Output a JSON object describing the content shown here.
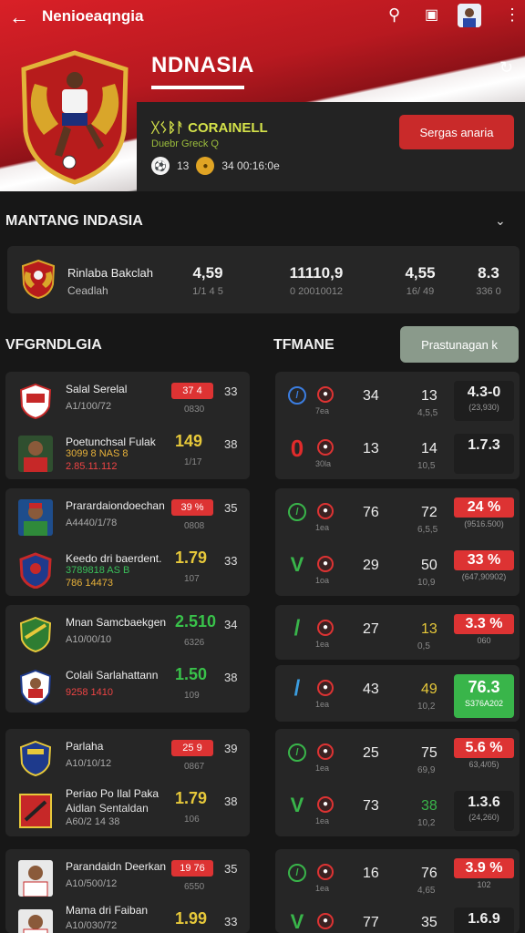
{
  "topbar": {
    "back_icon": "arrow-left-icon",
    "title": "Nenioeaqngia",
    "icons": [
      "search-icon",
      "share-icon",
      "avatar",
      "more-vertical-icon"
    ]
  },
  "hero": {
    "team_name": "NDNASIA",
    "subtitle": "ᚷᛊᛒᚨ CORAINELL",
    "subtitle2": "Duebr Greck Q",
    "stat1": "13",
    "stat2": "34 00:16:0e",
    "button": "Sergas anaria"
  },
  "section1": {
    "title": "MANTANG INDASIA",
    "summary": {
      "name": "Rinlaba Bakclah",
      "sub": "Ceadlah",
      "cols": [
        {
          "v": "4,59",
          "s": "1/1 4 5"
        },
        {
          "v": "11110,9",
          "s": "0 20010012"
        },
        {
          "v": "4,55",
          "s": "16/ 49"
        },
        {
          "v": "8.3",
          "s": "336 0"
        }
      ]
    }
  },
  "section2": {
    "left_title": "VFGRNDLGIA",
    "right_title": "TFMANE",
    "button": "Prastunagan k"
  },
  "left_cards": [
    {
      "rows": [
        {
          "name": "Salal Serelal",
          "sub": "A1/100/72",
          "pill": "37 4",
          "small": "0830",
          "rv": "33"
        },
        {
          "name": "Poetunchsal Fulak",
          "sub": "3099 8 NAS 8",
          "sub2": "2.85.11.112",
          "big": "149",
          "small": "1/17",
          "rv": "38"
        }
      ]
    },
    {
      "rows": [
        {
          "name": "Prarardaiondoechan",
          "sub": "A4440/1/78",
          "pill": "39 %",
          "small": "0808",
          "rv": "35"
        },
        {
          "name": "Keedo dri baerdent.",
          "sub": "3789818 AS B",
          "sub2": "786 14473",
          "big": "1.79",
          "small": "107",
          "rv": "33"
        }
      ]
    },
    {
      "rows": [
        {
          "name": "Mnan Samcbaekgen",
          "sub": "A10/00/10",
          "big": "2.510",
          "small": "6326",
          "rv": "34"
        },
        {
          "name": "Colali Sarlahattann",
          "sub": "9258 1410",
          "big": "1.50",
          "small": "109",
          "rv": "38"
        }
      ]
    },
    {
      "rows": [
        {
          "name": "Parlaha",
          "sub": "A10/10/12",
          "pill": "25 9",
          "small": "0867",
          "rv": "39"
        },
        {
          "name": "Periao Po Ilal Paka",
          "sub": "Aidlan Sentaldan",
          "sub2": "A60/2 14 38",
          "big": "1.79",
          "small": "106",
          "rv": "38"
        }
      ]
    },
    {
      "rows": [
        {
          "name": "Parandaidn Deerkan",
          "sub": "A10/500/12",
          "pill": "19 76",
          "small": "6550",
          "rv": "35"
        },
        {
          "name": "Mama dri Faiban",
          "sub": "A10/030/72",
          "big": "1.99",
          "small": "",
          "rv": "33"
        }
      ]
    }
  ],
  "right_cards": [
    {
      "rows": [
        {
          "mark": "/",
          "mark_color": "#3b7de0",
          "ic_label": "7ea",
          "c1": "34",
          "c2": "13",
          "c2s": "4,5,5",
          "bv": "4.3-0",
          "bs": "(23,930)",
          "box": "plain"
        },
        {
          "mark": "0",
          "mark_color": "#e02b2b",
          "ic_label": "30la",
          "c1": "13",
          "c2": "14",
          "c2s": "10,5",
          "bv": "1.7.3",
          "bs": "",
          "box": "plain"
        }
      ]
    },
    {
      "rows": [
        {
          "mark": "/",
          "mark_color": "#39b54a",
          "ic_label": "1ea",
          "c1": "76",
          "c2": "72",
          "c2s": "6,5,5",
          "bv": "24 %",
          "bs": "(9516.500)",
          "box": "redtop"
        },
        {
          "mark": "V",
          "mark_color": "#39b54a",
          "ic_label": "1oa",
          "c1": "29",
          "c2": "50",
          "c2s": "10,9",
          "bv": "33 %",
          "bs": "(647,90902)",
          "box": "redtop"
        }
      ]
    },
    {
      "rows": [
        {
          "mark": "/",
          "mark_color": "#39b54a",
          "ic_label": "1ea",
          "c1": "27",
          "c2": "13",
          "c2_color": "#e6c83a",
          "c2s": "0,5",
          "bv": "3.3 %",
          "bs": "060",
          "box": "redtop"
        }
      ]
    },
    {
      "rows": [
        {
          "mark": "/",
          "mark_color": "#3b9de0",
          "ic_label": "1ea",
          "c1": "43",
          "c2": "49",
          "c2_color": "#e6c83a",
          "c2s": "10,2",
          "bv": "76.3",
          "bs": "S376A202",
          "box": "green"
        }
      ]
    },
    {
      "rows": [
        {
          "mark": "/",
          "mark_color": "#39b54a",
          "ic_label": "1ea",
          "c1": "25",
          "c2": "75",
          "c2s": "69,9",
          "bv": "5.6 %",
          "bs": "63,4/05)",
          "box": "redtop"
        },
        {
          "mark": "V",
          "mark_color": "#39b54a",
          "ic_label": "1ea",
          "c1": "73",
          "c2": "38",
          "c2_color": "#39b54a",
          "c2s": "10,2",
          "bv": "1.3.6",
          "bs": "(24,260)",
          "box": "plain"
        }
      ]
    },
    {
      "rows": [
        {
          "mark": "/",
          "mark_color": "#39b54a",
          "ic_label": "1ea",
          "c1": "16",
          "c2": "76",
          "c2s": "4,65",
          "bv": "3.9 %",
          "bs": "102",
          "box": "redtop"
        },
        {
          "mark": "V",
          "mark_color": "#39b54a",
          "ic_label": "",
          "c1": "77",
          "c2": "35",
          "c2s": "",
          "bv": "1.6.9",
          "bs": "",
          "box": "plain"
        }
      ]
    }
  ]
}
